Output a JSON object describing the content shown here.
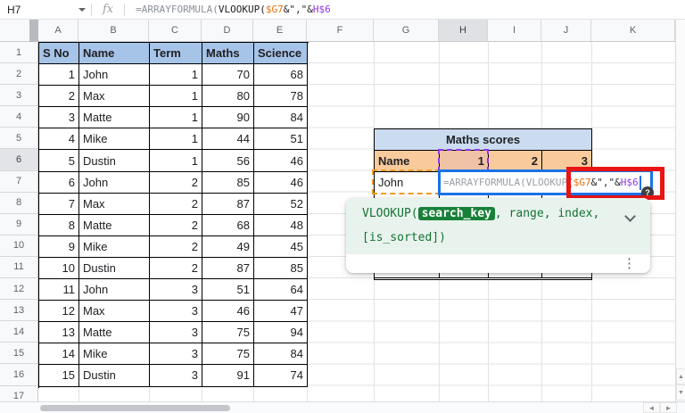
{
  "toolbar": {
    "cell_ref": "H7",
    "fx_label": "fx",
    "formula_parts": [
      {
        "text": "=ARRAYFORMULA(",
        "color": "#8A8F98"
      },
      {
        "text": "VLOOKUP(",
        "color": "#202124"
      },
      {
        "text": "$G7",
        "color": "#E8710A"
      },
      {
        "text": "&\",\"&",
        "color": "#202124"
      },
      {
        "text": "H$6",
        "color": "#9334E6"
      }
    ]
  },
  "sheet": {
    "column_letters": [
      "A",
      "B",
      "C",
      "D",
      "E",
      "F",
      "G",
      "H",
      "I",
      "J",
      "K"
    ],
    "row_numbers": [
      "1",
      "2",
      "3",
      "4",
      "5",
      "6",
      "7",
      "8",
      "9",
      "10",
      "11",
      "12",
      "13",
      "14",
      "15",
      "16",
      "17"
    ],
    "highlighted_column": "H",
    "highlighted_row": "6"
  },
  "table1": {
    "headers": [
      "S No",
      "Name",
      "Term",
      "Maths",
      "Science"
    ],
    "rows": [
      [
        "1",
        "John",
        "1",
        "70",
        "68"
      ],
      [
        "2",
        "Max",
        "1",
        "80",
        "78"
      ],
      [
        "3",
        "Matte",
        "1",
        "90",
        "84"
      ],
      [
        "4",
        "Mike",
        "1",
        "44",
        "51"
      ],
      [
        "5",
        "Dustin",
        "1",
        "56",
        "46"
      ],
      [
        "6",
        "John",
        "2",
        "85",
        "46"
      ],
      [
        "7",
        "Max",
        "2",
        "87",
        "52"
      ],
      [
        "8",
        "Matte",
        "2",
        "68",
        "48"
      ],
      [
        "9",
        "Mike",
        "2",
        "49",
        "45"
      ],
      [
        "10",
        "Dustin",
        "2",
        "87",
        "85"
      ],
      [
        "11",
        "John",
        "3",
        "51",
        "64"
      ],
      [
        "12",
        "Max",
        "3",
        "46",
        "47"
      ],
      [
        "13",
        "Matte",
        "3",
        "75",
        "94"
      ],
      [
        "14",
        "Mike",
        "3",
        "75",
        "84"
      ],
      [
        "15",
        "Dustin",
        "3",
        "91",
        "74"
      ]
    ]
  },
  "table2": {
    "title": "Maths scores",
    "name_header": "Name",
    "col1": "1",
    "col2": "2",
    "col3": "3",
    "first_name": "John"
  },
  "editor": {
    "ghost_text": "=ARRAYFORMULA(VLOOKUP",
    "parts": [
      {
        "text": "(",
        "color": "#202124"
      },
      {
        "text": "$G7",
        "color": "#E8710A"
      },
      {
        "text": "&\",\"&",
        "color": "#202124"
      },
      {
        "text": "H$6",
        "color": "#9334E6"
      }
    ]
  },
  "tooltip": {
    "fn_prefix": "VLOOKUP(",
    "chip": "search_key",
    "args_rest": ", range, index,",
    "line2": "[is_sorted])"
  },
  "help_badge": "?",
  "icons": {
    "scroll_up": "▲",
    "scroll_down": "▼",
    "scroll_left": "◄",
    "scroll_right": "►",
    "kebab": "⋮"
  },
  "colors": {
    "table1_header_bg": "#A6C3E8",
    "table2_title_bg": "#CBDCF0",
    "table2_header_bg": "#F9CB9C",
    "reference_orange": "#E8710A",
    "reference_purple": "#9334E6",
    "edit_border_blue": "#1A73E8",
    "annotation_red": "#E91414",
    "tooltip_text_green": "#137333",
    "chip_bg": "#188038"
  }
}
